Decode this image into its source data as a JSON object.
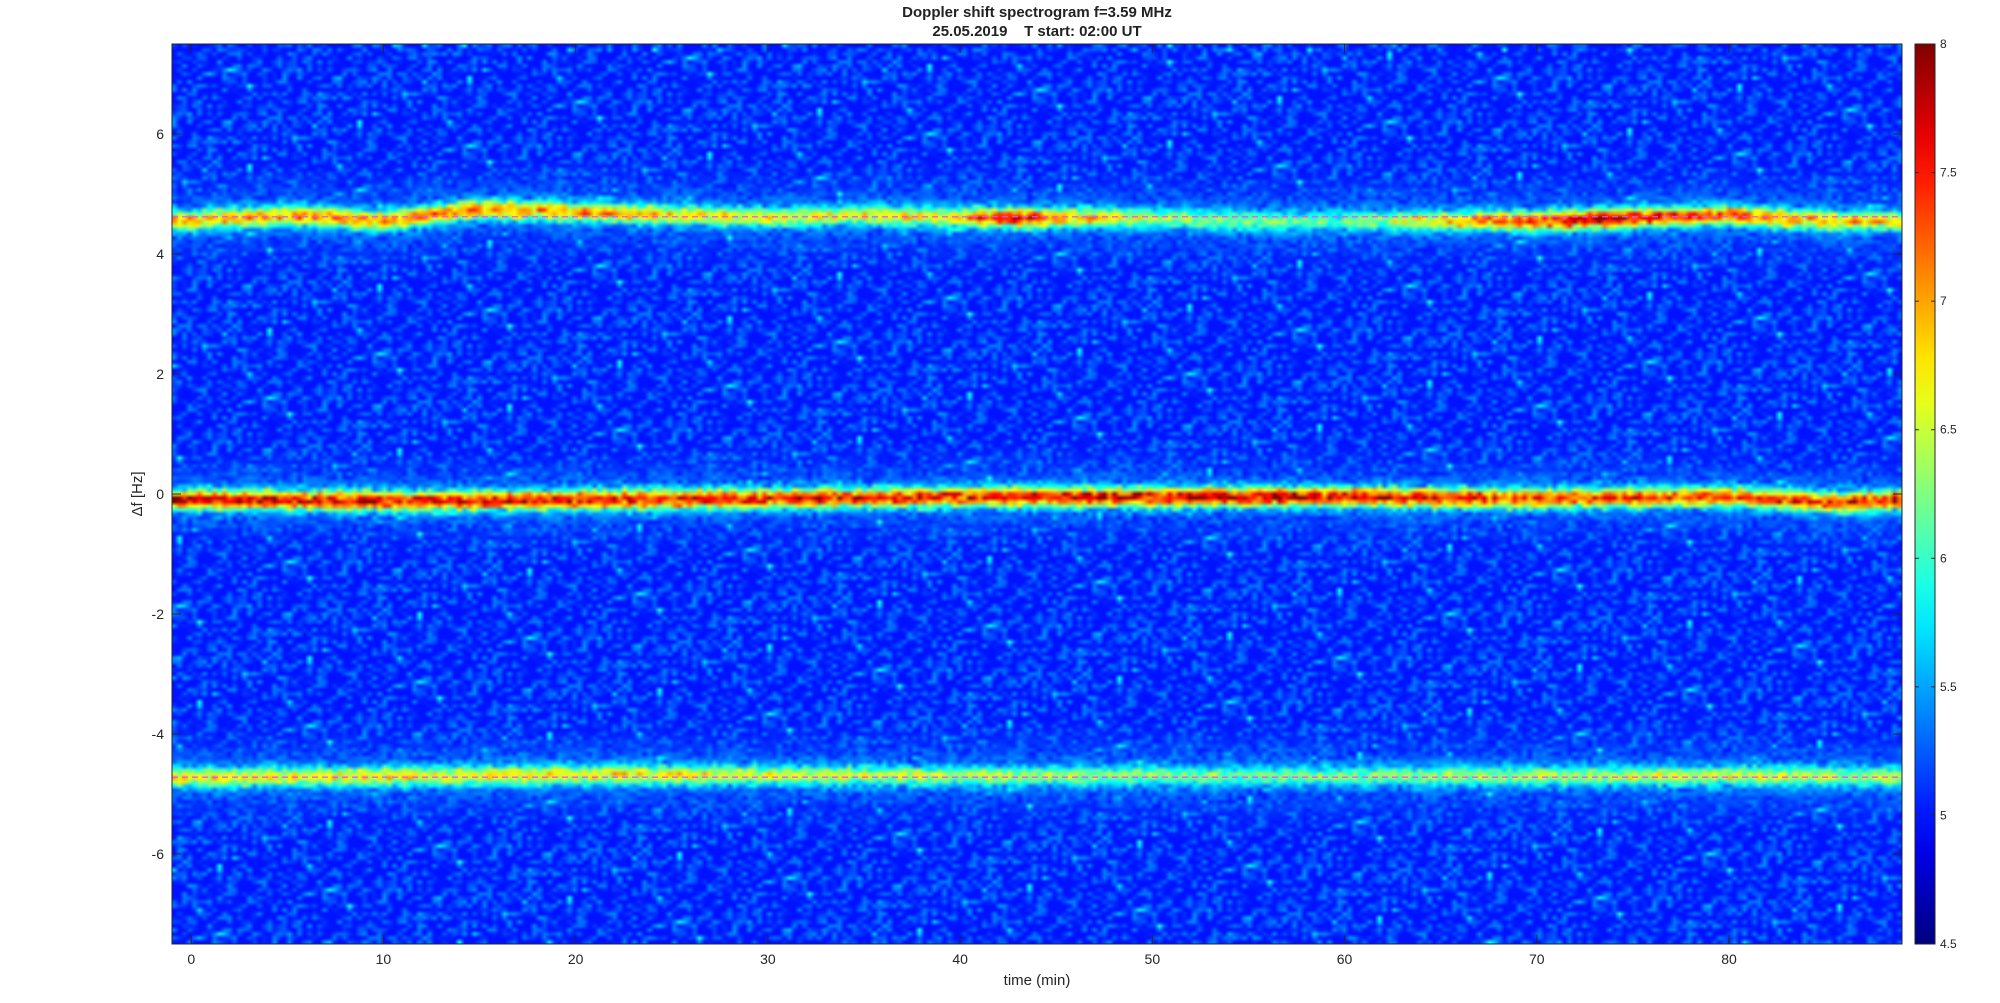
{
  "chart_data": {
    "type": "heatmap",
    "title": "Doppler shift spectrogram f=3.59 MHz",
    "subtitle": "25.05.2019    T start: 02:00 UT",
    "xlabel": "time (min)",
    "ylabel": "Δf [Hz]",
    "xlim": [
      -1,
      89
    ],
    "ylim": [
      -7.5,
      7.5
    ],
    "xticks": [
      0,
      10,
      20,
      30,
      40,
      50,
      60,
      70,
      80
    ],
    "yticks": [
      -6,
      -4,
      -2,
      0,
      2,
      4,
      6
    ],
    "colorbar": {
      "range": [
        4.5,
        8
      ],
      "ticks": [
        4.5,
        5,
        5.5,
        6,
        6.5,
        7,
        7.5,
        8
      ],
      "colormap": "jet",
      "position": "right"
    },
    "background_level": 5,
    "traces": [
      {
        "freq": [
          [
            0,
            4.55
          ],
          [
            5,
            4.65
          ],
          [
            10,
            4.55
          ],
          [
            15,
            4.75
          ],
          [
            20,
            4.7
          ],
          [
            25,
            4.65
          ],
          [
            30,
            4.6
          ],
          [
            35,
            4.65
          ],
          [
            40,
            4.6
          ],
          [
            45,
            4.6
          ],
          [
            50,
            4.6
          ],
          [
            55,
            4.55
          ],
          [
            60,
            4.55
          ],
          [
            65,
            4.55
          ],
          [
            70,
            4.55
          ],
          [
            75,
            4.6
          ],
          [
            80,
            4.65
          ],
          [
            85,
            4.55
          ],
          [
            89,
            4.55
          ]
        ],
        "intensity": [
          [
            0,
            6.8
          ],
          [
            10,
            7.0
          ],
          [
            20,
            6.9
          ],
          [
            30,
            6.4
          ],
          [
            40,
            6.6
          ],
          [
            42,
            7.6
          ],
          [
            50,
            6.2
          ],
          [
            60,
            5.9
          ],
          [
            66,
            6.8
          ],
          [
            73,
            7.7
          ],
          [
            80,
            7.1
          ],
          [
            89,
            6.6
          ]
        ]
      },
      {
        "freq": [
          [
            0,
            -0.1
          ],
          [
            10,
            -0.12
          ],
          [
            20,
            -0.1
          ],
          [
            30,
            -0.08
          ],
          [
            40,
            -0.05
          ],
          [
            50,
            -0.05
          ],
          [
            60,
            -0.05
          ],
          [
            70,
            -0.08
          ],
          [
            80,
            -0.05
          ],
          [
            86,
            -0.15
          ],
          [
            89,
            -0.1
          ]
        ],
        "intensity": [
          [
            0,
            7.6
          ],
          [
            20,
            7.5
          ],
          [
            40,
            7.4
          ],
          [
            55,
            7.7
          ],
          [
            70,
            7.2
          ],
          [
            89,
            7.4
          ]
        ]
      },
      {
        "freq": [
          [
            0,
            -4.73
          ],
          [
            20,
            -4.68
          ],
          [
            40,
            -4.7
          ],
          [
            60,
            -4.7
          ],
          [
            80,
            -4.7
          ],
          [
            89,
            -4.72
          ]
        ],
        "intensity": [
          [
            0,
            6.5
          ],
          [
            20,
            6.6
          ],
          [
            40,
            6.2
          ],
          [
            60,
            6.0
          ],
          [
            80,
            6.4
          ],
          [
            89,
            6.2
          ]
        ]
      }
    ],
    "reference_lines": [
      {
        "freq": 4.62,
        "color": "#ff44ff",
        "style": "dashed"
      },
      {
        "freq": -4.72,
        "color": "#ff44ff",
        "style": "dashed"
      }
    ],
    "colors": {
      "axes": "#262626",
      "ref_line": "#ff44ff"
    }
  }
}
